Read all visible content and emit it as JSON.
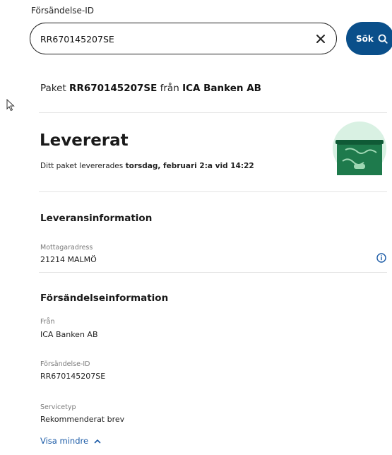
{
  "search": {
    "label": "Försändelse-ID",
    "value": "RR670145207SE",
    "button_label": "Sök"
  },
  "package": {
    "prefix": "Paket",
    "id": "RR670145207SE",
    "from_word": "från",
    "sender": "ICA Banken AB"
  },
  "status": {
    "title": "Levererat",
    "desc_prefix": "Ditt paket levererades",
    "desc_date": "torsdag, februari 2:a vid 14:22"
  },
  "delivery_info": {
    "title": "Leveransinformation",
    "recipient_label": "Mottagaradress",
    "recipient_value": "21214 MALMÖ"
  },
  "shipment_info": {
    "title": "Försändelseinformation",
    "from_label": "Från",
    "from_value": "ICA Banken AB",
    "id_label": "Försändelse-ID",
    "id_value": "RR670145207SE",
    "service_label": "Servicetyp",
    "service_value": "Rekommenderat brev"
  },
  "toggle": {
    "label": "Visa mindre"
  },
  "colors": {
    "primary": "#0a4f8a",
    "link": "#1a5aa6",
    "mailbox_green": "#1e7a4c",
    "mailbox_bg": "#d9f1e3"
  },
  "icons": [
    "clear-icon",
    "search-icon",
    "mailbox-icon",
    "info-icon",
    "chevron-up-icon",
    "cursor-icon"
  ]
}
